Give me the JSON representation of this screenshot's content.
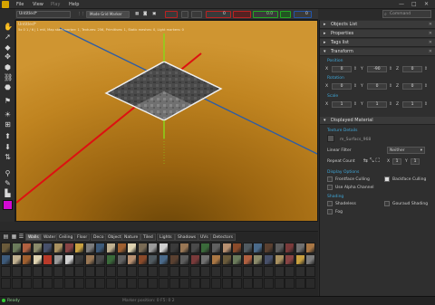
{
  "menubar": {
    "file": "File",
    "view": "View",
    "play": "Play",
    "help": "Help",
    "minimize": "—",
    "maximize": "□",
    "close": "✕"
  },
  "toolbar": {
    "scene_name": "Untitled*",
    "mode": "Mode Grid Marker",
    "x_value": "0",
    "y_value": "0",
    "z_value": "0",
    "search_placeholder": "Command"
  },
  "viewport": {
    "stats": "5x 0 1 / 6  | 1 mtl, Map start marker: 1, Textures: 256, Primitives: 1, Static meshes: 0, Light markers: 0"
  },
  "right_panel": {
    "objects_list": "Objects List",
    "properties": "Properties",
    "tags_list": "Tags list",
    "transform": "Transform",
    "position_label": "Position",
    "rotation_label": "Rotation",
    "scale_label": "Scale",
    "position": {
      "x": "0",
      "y": "-90",
      "z": "0"
    },
    "rotation": {
      "x": "0",
      "y": "0",
      "z": "0"
    },
    "scale": {
      "x": "1",
      "y": "1",
      "z": "1"
    },
    "displayed_material": "Displayed Material",
    "texture_details": "Texture Details",
    "texture_name": "m_Surfacs_968",
    "linear_filter": "Linear Filter",
    "filter_value": "Neither",
    "repeat_count": "Repeat Count",
    "repeat_x": "1",
    "repeat_y": "1",
    "display_options": "Display Options",
    "frontface_culling": "Frontface Culling",
    "backface_culling": "Backface Culling",
    "use_alpha": "Use Alpha Channel",
    "shading": "Shading",
    "shadeless": "Shadeless",
    "gouraud": "Gouraud Shading",
    "fog": "Fog"
  },
  "browser": {
    "tabs": [
      "Walls",
      "Water",
      "Ceiling",
      "Floor",
      "Deco",
      "Object",
      "Nature",
      "Tiled",
      "Lights",
      "Shadows",
      "UVs",
      "Detectors"
    ]
  },
  "status": {
    "left": "Ready",
    "center": "Marker position: 0     F5: 0    2"
  },
  "colors": {
    "accent": "#3fa7d8",
    "viewport_floor": "#c48a20",
    "pink_tool": "#d40ad4"
  }
}
